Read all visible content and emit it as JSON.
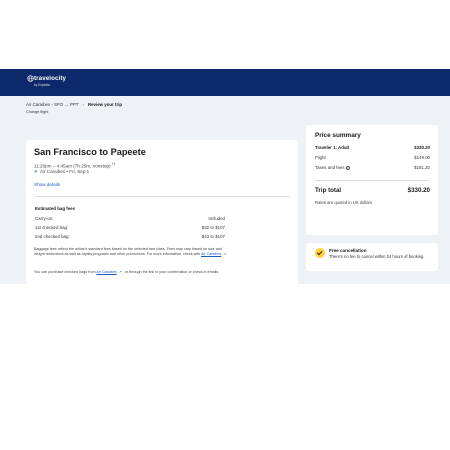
{
  "brand": {
    "name": "travelocity",
    "sub": "by Expedia"
  },
  "breadcrumb": {
    "route": "Air Caraibes - SFO → PPT",
    "current": "Review your trip",
    "change": "Change flight"
  },
  "flight": {
    "title": "San Francisco to Papeete",
    "time": "11:20pm – 4:45am (7h 25m, nonstop)",
    "day_offset": "+1",
    "airline": "Air Caraibes • Fri, Sep 1",
    "show_details": "Show details"
  },
  "bags": {
    "title": "Estimated bag fees",
    "rows": [
      {
        "label": "Carry-on:",
        "value": "Included"
      },
      {
        "label": "1st checked bag:",
        "value": "$32 to $107"
      },
      {
        "label": "2nd checked bag:",
        "value": "$43 to $107"
      }
    ],
    "disclaimer": "Baggage fees reflect the airline's standard fees based on the selected fare class. Fees may vary based on size and weight restrictions as well as loyalty programs and other promotions. For more information, check with",
    "disclaimer_link": "Air Caraibes",
    "purchase_text_1": "You can purchase checked bags from",
    "purchase_link": "Air Caraibes",
    "purchase_text_2": "or through the link in your confirmation or check-in emails."
  },
  "price_summary": {
    "title": "Price summary",
    "traveler_label": "Traveler 1: Adult",
    "traveler_value": "$330.20",
    "flight_label": "Flight",
    "flight_value": "$149.00",
    "taxes_label": "Taxes and fees",
    "taxes_value": "$181.20",
    "total_label": "Trip total",
    "total_value": "$330.20",
    "note": "Rates are quoted in US dollars"
  },
  "cancellation": {
    "title": "Free cancellation",
    "text": "There's no fee to cancel within 24 hours of booking."
  }
}
